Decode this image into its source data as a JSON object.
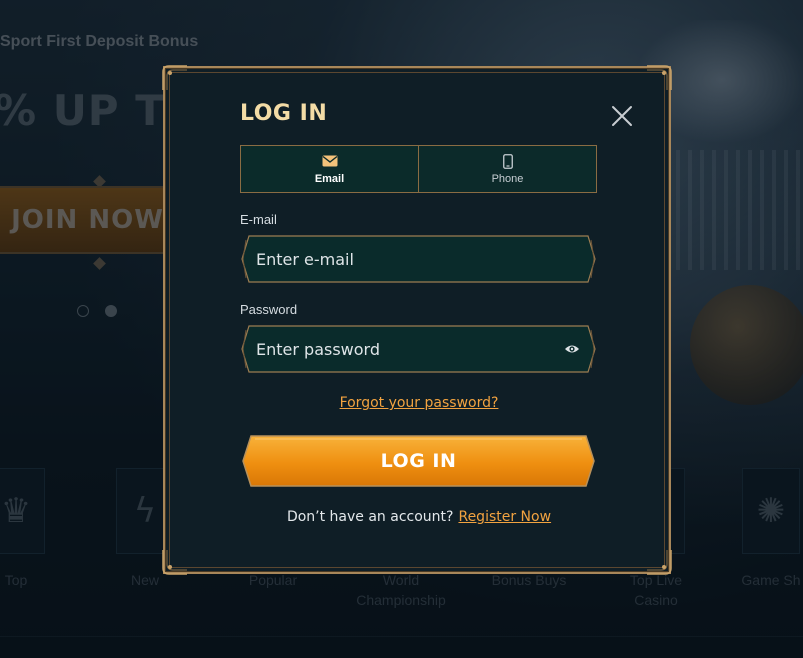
{
  "background": {
    "promo_text": "Sport First Deposit Bonus",
    "promo_big": "% UP TO",
    "join_button": "JOIN NOW",
    "carousel_dots": 2,
    "categories": [
      {
        "label": "Top",
        "icon": "crown-icon"
      },
      {
        "label": "New",
        "icon": "lightning-icon"
      },
      {
        "label": "Popular",
        "icon": "star-icon"
      },
      {
        "label": "World Championship",
        "icon": "trophy-icon"
      },
      {
        "label": "Bonus Buys",
        "icon": "gift-icon"
      },
      {
        "label": "Top Live Casino",
        "icon": "roulette-icon"
      },
      {
        "label": "Game Sh",
        "icon": "wheel-icon"
      }
    ]
  },
  "modal": {
    "title": "LOG IN",
    "tabs": [
      {
        "label": "Email",
        "icon": "envelope-icon",
        "active": true
      },
      {
        "label": "Phone",
        "icon": "phone-icon",
        "active": false
      }
    ],
    "email": {
      "label": "E-mail",
      "placeholder": "Enter e-mail",
      "value": ""
    },
    "password": {
      "label": "Password",
      "placeholder": "Enter password",
      "value": ""
    },
    "forgot_link": "Forgot your password?",
    "login_button": "LOG IN",
    "register_text": "Don’t have an account?",
    "register_link": "Register Now"
  },
  "colors": {
    "accent_gold": "#a8875a",
    "title": "#f3dca6",
    "link_orange": "#f2a340",
    "button_orange": "#f09a1a",
    "modal_bg": "#0f1e26",
    "field_bg": "#0a2b2b"
  }
}
